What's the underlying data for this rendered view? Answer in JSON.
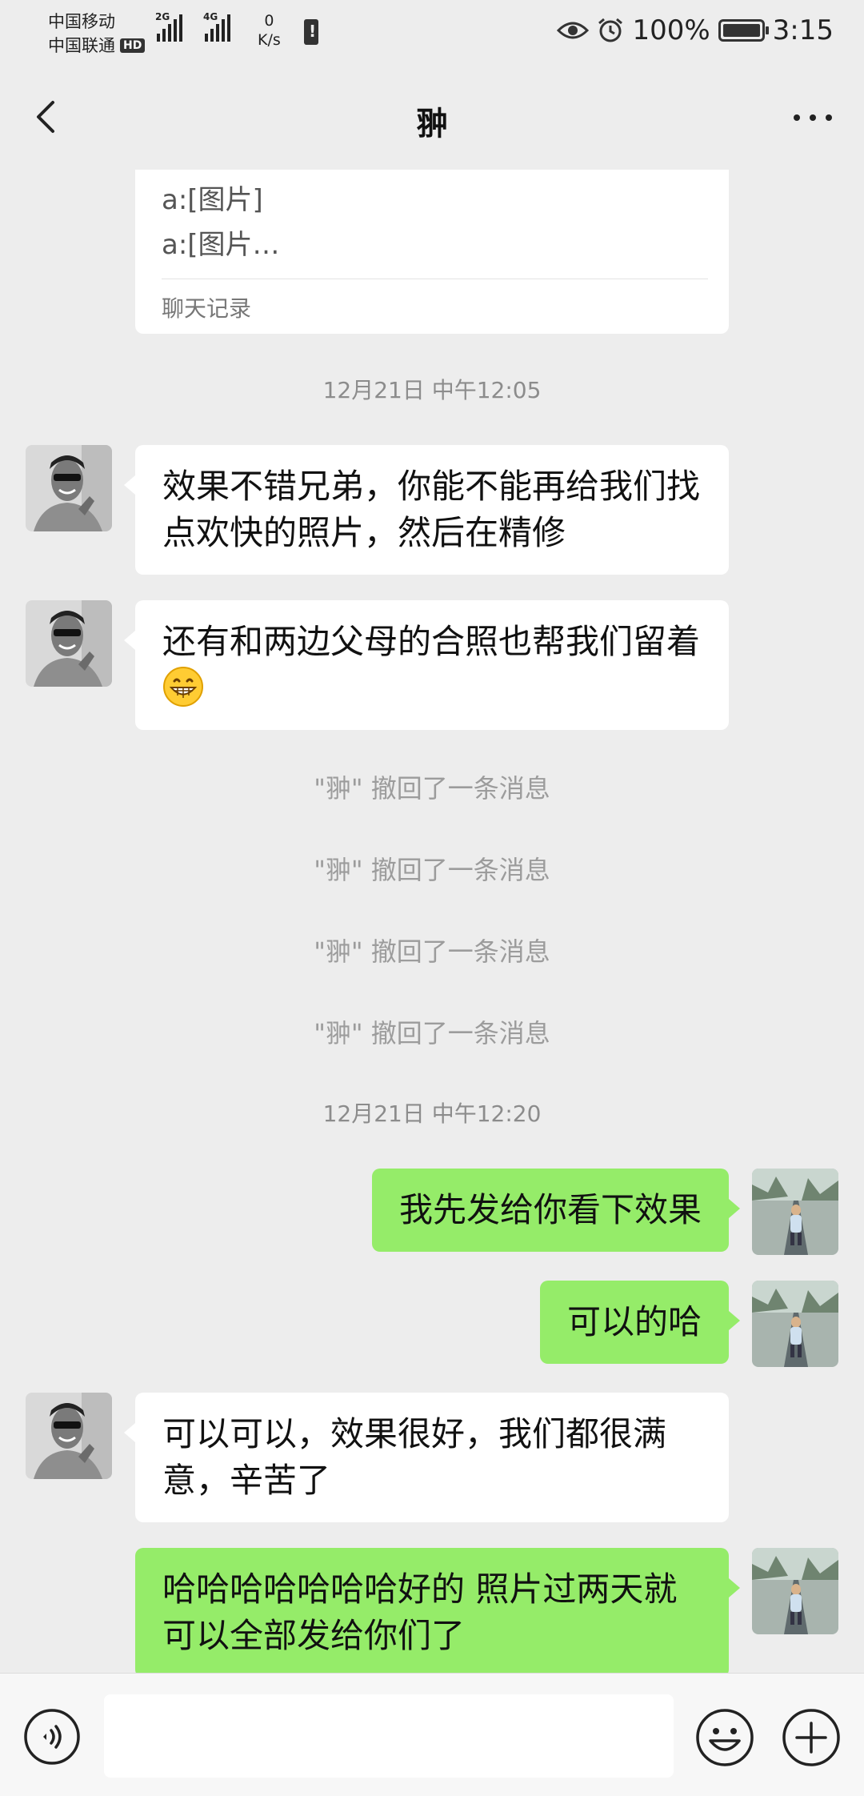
{
  "status_bar": {
    "carrier1": "中国移动",
    "carrier2": "中国联通",
    "hd_badge": "HD",
    "sig1_label": "2G",
    "sig2_label": "4G",
    "net_speed_value": "0",
    "net_speed_unit": "K/s",
    "battery": "100%",
    "time": "3:15"
  },
  "header": {
    "title": "翀",
    "back_icon": "chevron-left-icon",
    "more_icon": "more-dots-icon"
  },
  "chat": {
    "forwarded_card": {
      "line1": "a:[图片]",
      "line2": "a:[图片…",
      "footer": "聊天记录"
    },
    "time1": "12月21日 中午12:05",
    "msg1": "效果不错兄弟，你能不能再给我们找点欢快的照片，然后在精修",
    "msg2": "还有和两边父母的合照也帮我们留着",
    "msg2_emoji": "grinning-face-emoji",
    "recalls": [
      "\"翀\" 撤回了一条消息",
      "\"翀\" 撤回了一条消息",
      "\"翀\" 撤回了一条消息",
      "\"翀\" 撤回了一条消息"
    ],
    "time2": "12月21日 中午12:20",
    "msg3": "我先发给你看下效果",
    "msg4": "可以的哈",
    "msg5": "可以可以，效果很好，我们都很满意，辛苦了",
    "msg6": "哈哈哈哈哈哈哈好的  照片过两天就可以全部发给你们了"
  },
  "input_bar": {
    "voice_icon": "voice-icon",
    "input_value": "",
    "emoji_icon": "emoji-icon",
    "plus_icon": "plus-icon"
  },
  "colors": {
    "background": "#ededed",
    "incoming_bubble": "#ffffff",
    "outgoing_bubble": "#95ec69",
    "meta_text": "#8c8c8c"
  }
}
